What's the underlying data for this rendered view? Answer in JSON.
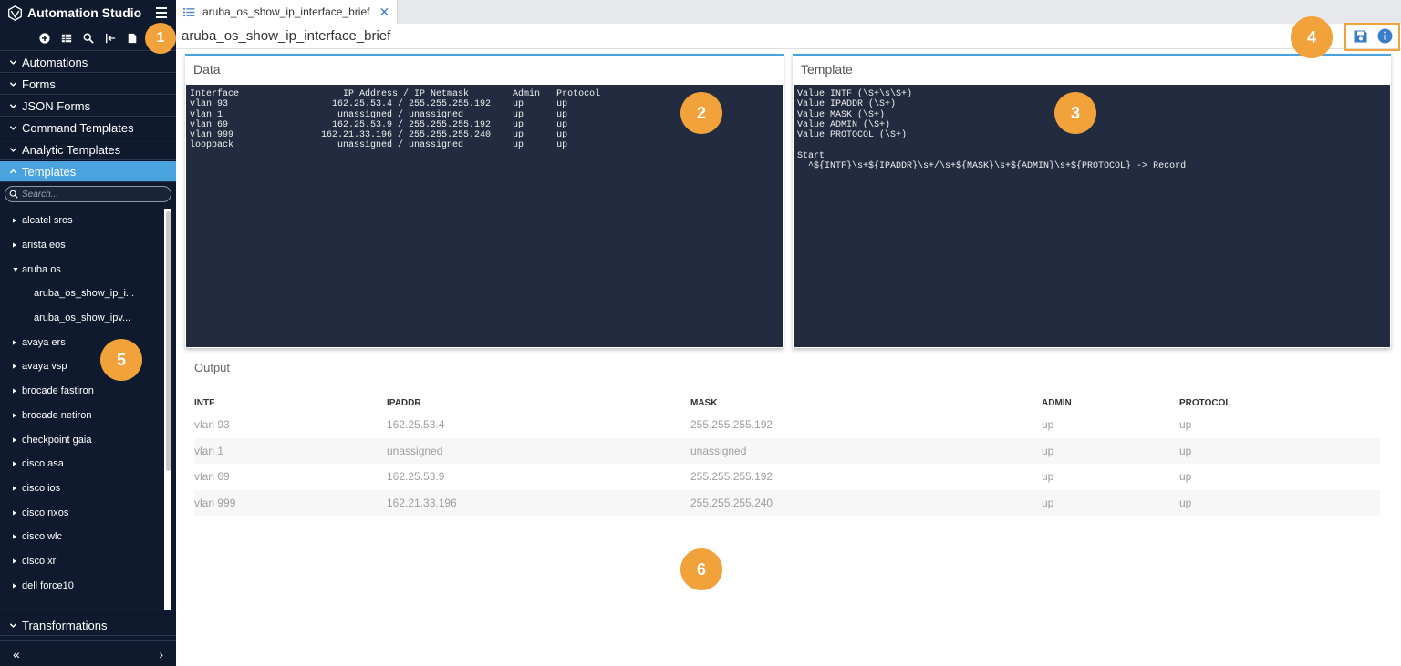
{
  "app": {
    "title": "Automation Studio"
  },
  "sidebar": {
    "sections_top": [
      {
        "label": "Automations"
      },
      {
        "label": "Forms"
      },
      {
        "label": "JSON Forms"
      },
      {
        "label": "Command Templates"
      },
      {
        "label": "Analytic Templates"
      }
    ],
    "active_section": {
      "label": "Templates"
    },
    "search": {
      "placeholder": "Search..."
    },
    "tree": [
      {
        "label": "alcatel sros",
        "type": "folder"
      },
      {
        "label": "arista eos",
        "type": "folder"
      },
      {
        "label": "aruba os",
        "type": "folder-open"
      },
      {
        "label": "aruba_os_show_ip_i...",
        "type": "child"
      },
      {
        "label": "aruba_os_show_ipv...",
        "type": "child"
      },
      {
        "label": "avaya ers",
        "type": "folder"
      },
      {
        "label": "avaya vsp",
        "type": "folder"
      },
      {
        "label": "brocade fastiron",
        "type": "folder"
      },
      {
        "label": "brocade netiron",
        "type": "folder"
      },
      {
        "label": "checkpoint gaia",
        "type": "folder"
      },
      {
        "label": "cisco asa",
        "type": "folder"
      },
      {
        "label": "cisco ios",
        "type": "folder"
      },
      {
        "label": "cisco nxos",
        "type": "folder"
      },
      {
        "label": "cisco wlc",
        "type": "folder"
      },
      {
        "label": "cisco xr",
        "type": "folder"
      },
      {
        "label": "dell force10",
        "type": "folder"
      }
    ],
    "section_bottom": {
      "label": "Transformations"
    },
    "footer": {
      "collapse": "«",
      "expand": "›"
    }
  },
  "tab": {
    "label": "aruba_os_show_ip_interface_brief",
    "close": "✕"
  },
  "page_title": "aruba_os_show_ip_interface_brief",
  "data_panel": {
    "title": "Data",
    "content": "Interface                   IP Address / IP Netmask        Admin   Protocol\nvlan 93                   162.25.53.4 / 255.255.255.192    up      up\nvlan 1                     unassigned / unassigned         up      up\nvlan 69                   162.25.53.9 / 255.255.255.192    up      up\nvlan 999                162.21.33.196 / 255.255.255.240    up      up\nloopback                   unassigned / unassigned         up      up"
  },
  "template_panel": {
    "title": "Template",
    "content": "Value INTF (\\S+\\s\\S+)\nValue IPADDR (\\S+)\nValue MASK (\\S+)\nValue ADMIN (\\S+)\nValue PROTOCOL (\\S+)\n\nStart\n  ^${INTF}\\s+${IPADDR}\\s+/\\s+${MASK}\\s+${ADMIN}\\s+${PROTOCOL} -> Record"
  },
  "output": {
    "label": "Output",
    "columns": [
      "INTF",
      "IPADDR",
      "MASK",
      "ADMIN",
      "PROTOCOL"
    ],
    "rows": [
      [
        "vlan 93",
        "162.25.53.4",
        "255.255.255.192",
        "up",
        "up"
      ],
      [
        "vlan 1",
        "unassigned",
        "unassigned",
        "up",
        "up"
      ],
      [
        "vlan 69",
        "162.25.53.9",
        "255.255.255.192",
        "up",
        "up"
      ],
      [
        "vlan 999",
        "162.21.33.196",
        "255.255.255.240",
        "up",
        "up"
      ]
    ]
  },
  "callouts": [
    "1",
    "2",
    "3",
    "4",
    "5",
    "6"
  ],
  "colors": {
    "sidebar_bg": "#0f1a2e",
    "accent": "#4aa3df",
    "callout": "#f2a23a",
    "code_bg": "#222b3f"
  },
  "icons": [
    "logo-icon",
    "menu-icon",
    "add-icon",
    "grid-icon",
    "search-icon",
    "import-icon",
    "file-icon",
    "save-icon",
    "info-icon",
    "list-icon",
    "close-icon"
  ]
}
